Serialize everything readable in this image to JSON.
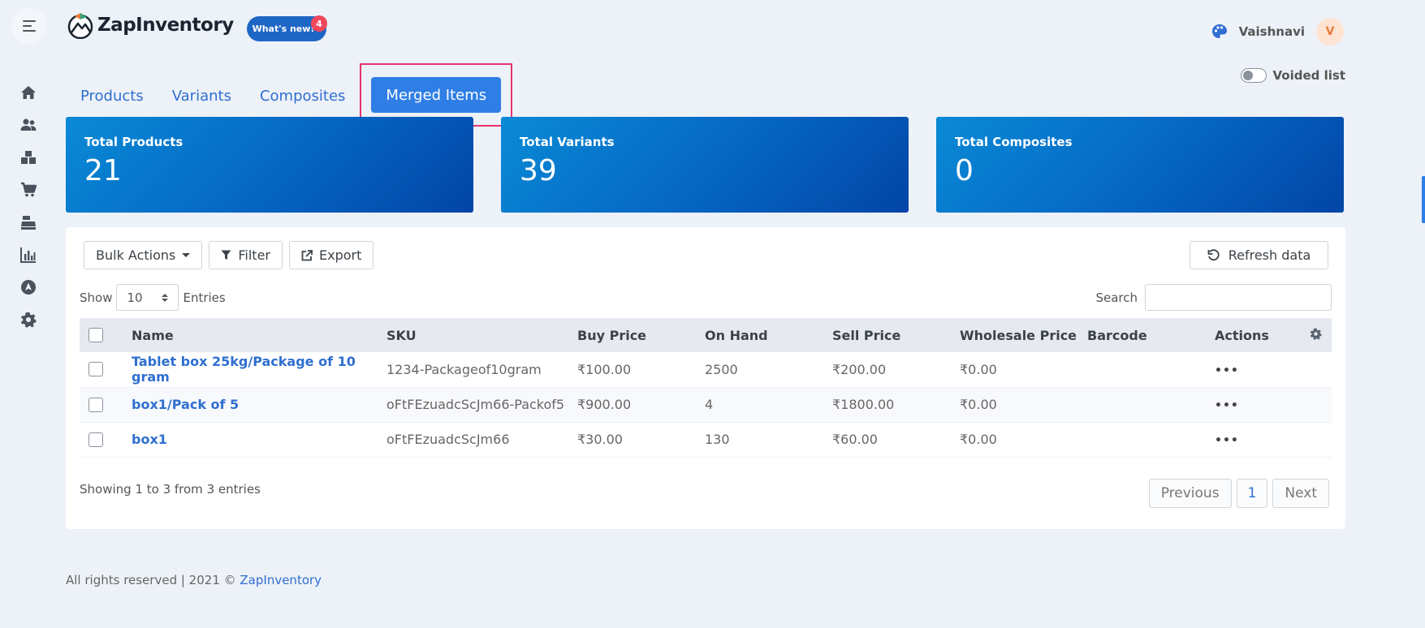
{
  "brand": {
    "name": "ZapInventory"
  },
  "header": {
    "whats_new_label": "What's new!",
    "whats_new_count": "4",
    "username": "Vaishnavi",
    "avatar_initial": "V"
  },
  "sidebar": {
    "items": [
      {
        "icon": "home-icon"
      },
      {
        "icon": "users-icon"
      },
      {
        "icon": "boxes-icon"
      },
      {
        "icon": "cart-icon"
      },
      {
        "icon": "cash-register-icon"
      },
      {
        "icon": "chart-icon"
      },
      {
        "icon": "compass-icon"
      },
      {
        "icon": "gear-icon"
      }
    ]
  },
  "tabs": [
    {
      "label": "Products"
    },
    {
      "label": "Variants"
    },
    {
      "label": "Composites"
    },
    {
      "label": "Merged Items",
      "active": true
    }
  ],
  "voided": {
    "label": "Voided list",
    "on": false
  },
  "stats": [
    {
      "label": "Total Products",
      "value": "21"
    },
    {
      "label": "Total Variants",
      "value": "39"
    },
    {
      "label": "Total Composites",
      "value": "0"
    }
  ],
  "toolbar": {
    "bulk_label": "Bulk Actions",
    "filter_label": "Filter",
    "export_label": "Export",
    "refresh_label": "Refresh data"
  },
  "entries": {
    "show_label": "Show",
    "value": "10",
    "suffix": "Entries"
  },
  "search": {
    "label": "Search",
    "value": ""
  },
  "table": {
    "columns": [
      "Name",
      "SKU",
      "Buy Price",
      "On Hand",
      "Sell Price",
      "Wholesale Price",
      "Barcode",
      "Actions"
    ],
    "rows": [
      {
        "name": "Tablet box 25kg/Package of 10 gram",
        "sku": "1234-Packageof10gram",
        "buy": "₹100.00",
        "onhand": "2500",
        "sell": "₹200.00",
        "wholesale": "₹0.00",
        "barcode": ""
      },
      {
        "name": "box1/Pack of 5",
        "sku": "oFtFEzuadcScJm66-Packof5",
        "buy": "₹900.00",
        "onhand": "4",
        "sell": "₹1800.00",
        "wholesale": "₹0.00",
        "barcode": ""
      },
      {
        "name": "box1",
        "sku": "oFtFEzuadcScJm66",
        "buy": "₹30.00",
        "onhand": "130",
        "sell": "₹60.00",
        "wholesale": "₹0.00",
        "barcode": ""
      }
    ]
  },
  "pagination": {
    "summary": "Showing 1 to 3 from 3 entries",
    "prev_label": "Previous",
    "page": "1",
    "next_label": "Next"
  },
  "footer": {
    "text": "All rights reserved | 2021 © ",
    "link": "ZapInventory"
  }
}
